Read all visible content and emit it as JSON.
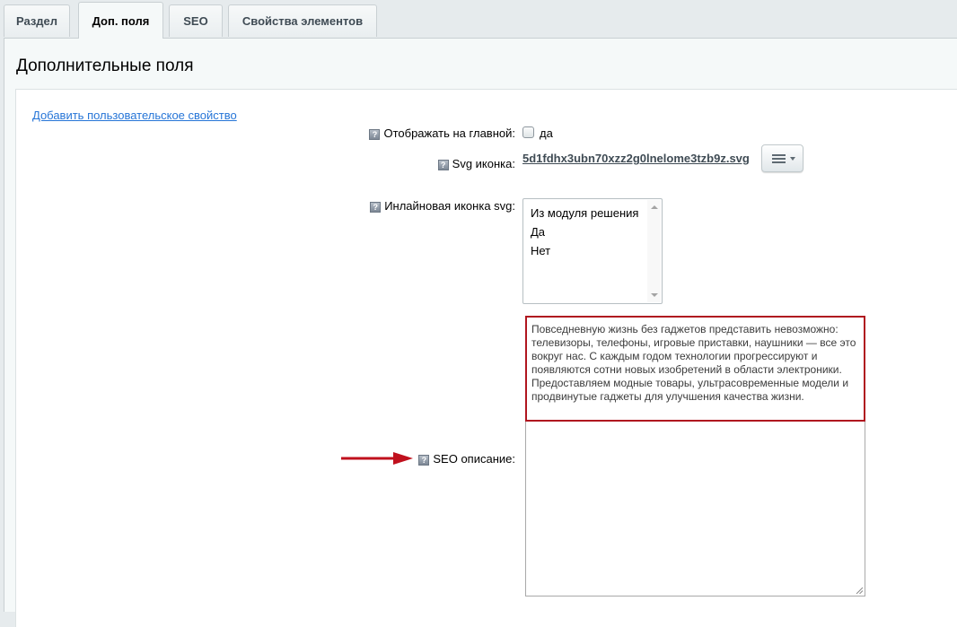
{
  "tabs": [
    {
      "label": "Раздел",
      "active": false
    },
    {
      "label": "Доп. поля",
      "active": true
    },
    {
      "label": "SEO",
      "active": false
    },
    {
      "label": "Свойства элементов",
      "active": false
    }
  ],
  "panel": {
    "title": "Дополнительные поля",
    "add_property_link": "Добавить пользовательское свойство"
  },
  "fields": {
    "show_on_main": {
      "help": "?",
      "label": "Отображать на главной:",
      "checkbox_label": "да",
      "checked": false
    },
    "svg_icon": {
      "help": "?",
      "label": "Svg иконка:",
      "file_name": "5d1fdhx3ubn70xzz2g0lnelome3tzb9z.svg",
      "menu_icon": "hamburger-dropdown-icon"
    },
    "inline_svg": {
      "help": "?",
      "label": "Инлайновая иконка svg:",
      "options": [
        "Из модуля решения",
        "Да",
        "Нет"
      ]
    },
    "seo_description": {
      "help": "?",
      "label": "SEO описание:",
      "value": "Повседневную жизнь без гаджетов представить невозможно: телевизоры, телефоны, игровые приставки, наушники — все это вокруг нас. С каждым годом технологии прогрессируют и появляются сотни новых изобретений в области электроники. Предоставляем модные товары, ультрасовременные модели и продвинутые гаджеты для улучшения качества жизни."
    }
  },
  "colors": {
    "link": "#2675d7",
    "highlight_border": "#b0161f",
    "arrow": "#c0101d",
    "panel_bg": "#f5f9f9",
    "page_bg": "#e6ebed"
  }
}
